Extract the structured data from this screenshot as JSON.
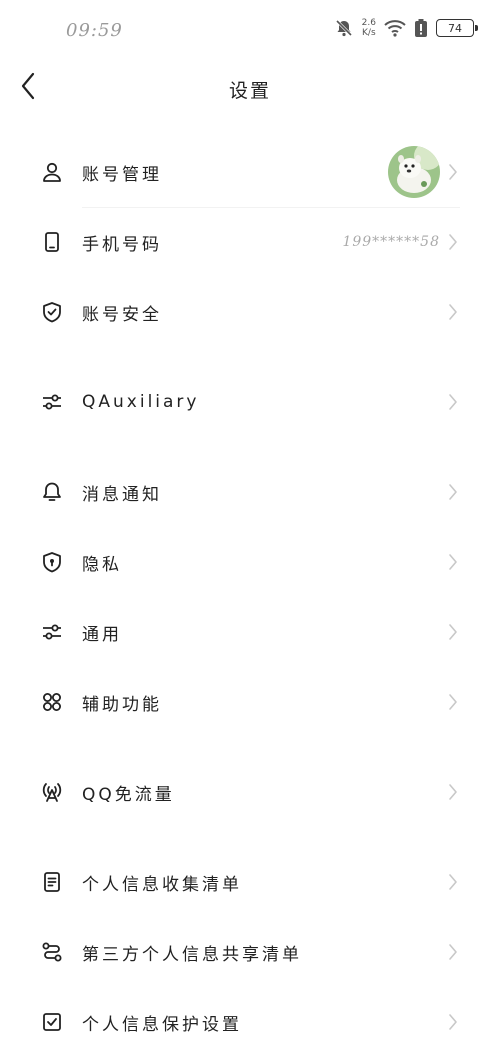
{
  "status_bar": {
    "time": "09:59",
    "net_speed_value": "2.6",
    "net_speed_unit": "K/s",
    "battery": "74",
    "icons": [
      "bell-muted-icon",
      "wifi-icon",
      "battery-alert-icon"
    ]
  },
  "header": {
    "title": "设置",
    "back_icon": "back-arrow-icon"
  },
  "rows": [
    {
      "label": "账号管理",
      "icon": "person-icon"
    },
    {
      "label": "手机号码",
      "icon": "phone-icon",
      "value": "199******58"
    },
    {
      "label": "账号安全",
      "icon": "shield-check-icon"
    },
    {
      "label": "QAuxiliary",
      "icon": "sliders-icon"
    },
    {
      "label": "消息通知",
      "icon": "bell-icon"
    },
    {
      "label": "隐私",
      "icon": "shield-lock-icon"
    },
    {
      "label": "通用",
      "icon": "sliders-icon"
    },
    {
      "label": "辅助功能",
      "icon": "grid-circles-icon"
    },
    {
      "label": "QQ免流量",
      "icon": "signal-tower-icon"
    },
    {
      "label": "个人信息收集清单",
      "icon": "document-icon"
    },
    {
      "label": "第三方个人信息共享清单",
      "icon": "share-flow-icon"
    },
    {
      "label": "个人信息保护设置",
      "icon": "checkbox-icon"
    }
  ],
  "colors": {
    "text": "#222222",
    "muted": "#aaaaaa",
    "chevron": "#c8c8c8",
    "background": "#ffffff"
  }
}
